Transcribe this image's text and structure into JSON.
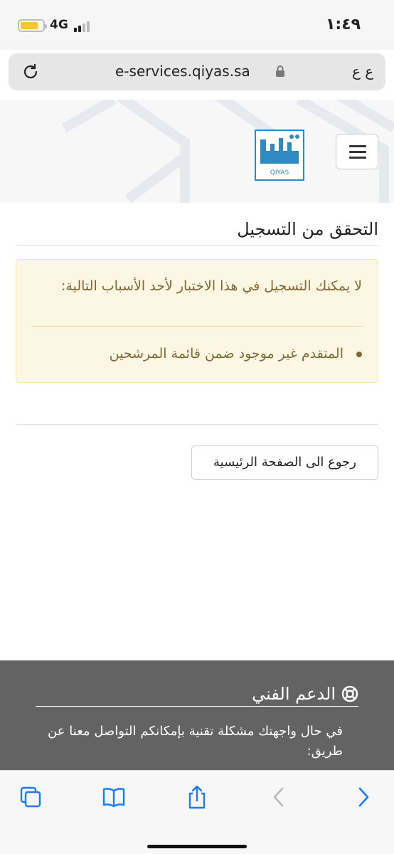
{
  "status_bar": {
    "time": "١:٤٩",
    "network": "4G"
  },
  "browser": {
    "url": "e-services.qiyas.sa",
    "text_size_label": "ع ع"
  },
  "header": {
    "logo_text": "QIYAS",
    "menu_icon": "hamburger-menu-icon"
  },
  "main": {
    "title": "التحقق من التسجيل",
    "alert": {
      "message": "لا يمكنك التسجيل في هذا الاختبار لأحد الأسباب التالية:",
      "reasons": [
        "المتقدم غير موجود ضمن قائمة المرشحين"
      ]
    },
    "home_button_label": "رجوع الى الصفحة الرئيسية"
  },
  "footer": {
    "support_title": "الدعم الفني",
    "support_text": "في حال واجهتك مشكلة تقنية بإمكانكم التواصل معنا عن طريق:"
  },
  "toolbar": {
    "icons": [
      "tabs-icon",
      "bookmarks-icon",
      "share-icon",
      "back-icon",
      "forward-icon"
    ]
  },
  "colors": {
    "alert_bg": "#fcf7e3",
    "alert_text": "#7f6737",
    "footer_bg": "#636363",
    "link_blue": "#1a7cf5",
    "logo_blue": "#2f8ac4"
  }
}
